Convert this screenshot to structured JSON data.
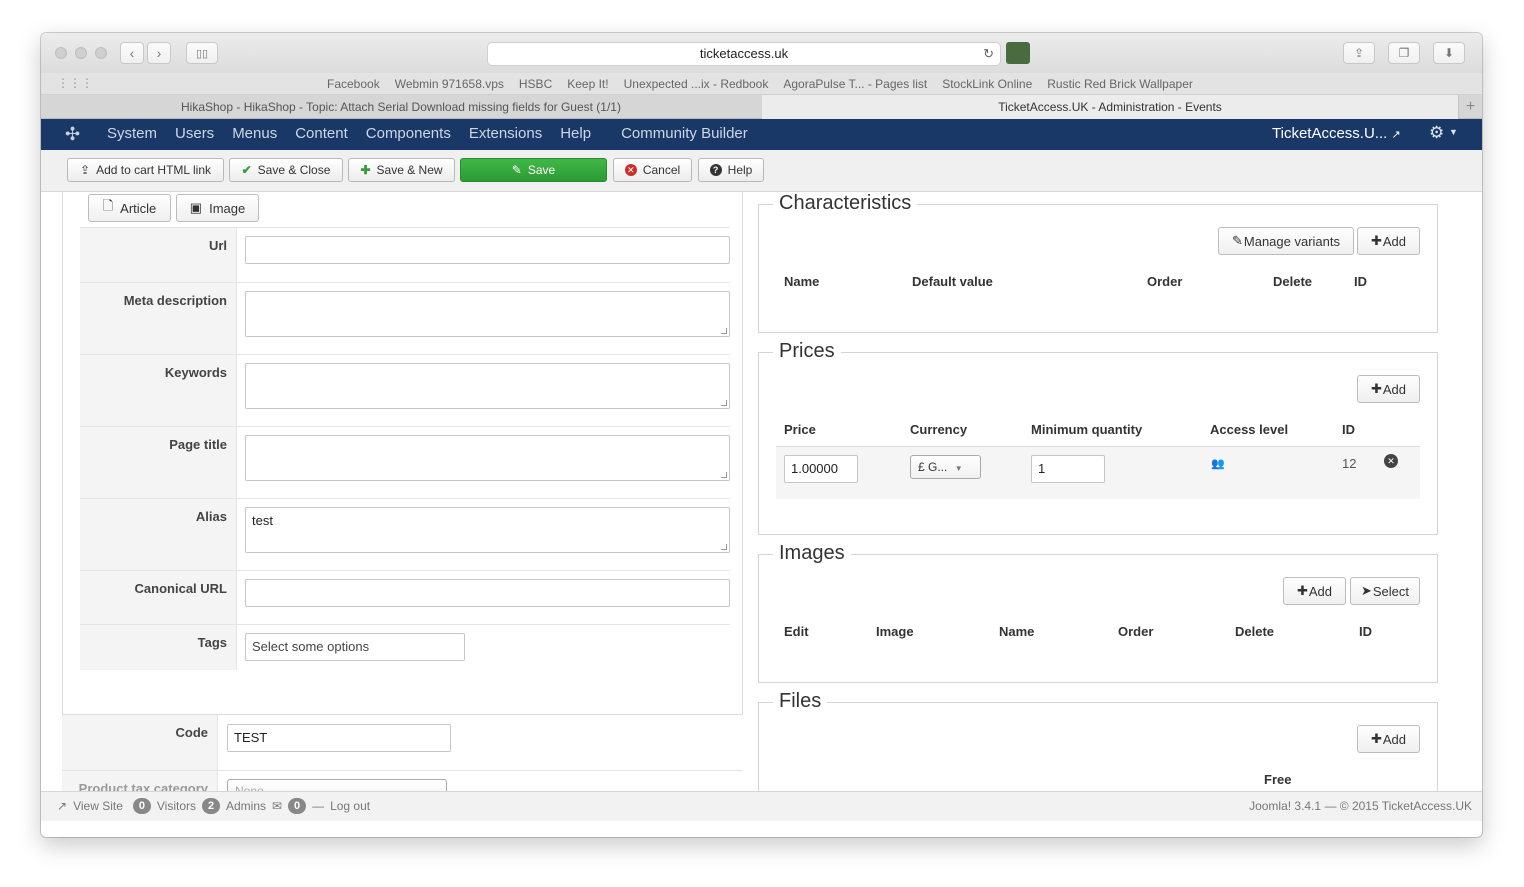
{
  "browser": {
    "url": "ticketaccess.uk",
    "bookmarks": [
      "Facebook",
      "Webmin 971658.vps",
      "HSBC",
      "Keep It!",
      "Unexpected ...ix - Redbook",
      "AgoraPulse T... - Pages list",
      "StockLink Online",
      "Rustic Red Brick Wallpaper"
    ],
    "tabs": [
      {
        "title": "HikaShop - HikaShop - Topic: Attach Serial Download missing fields for Guest (1/1)",
        "active": false
      },
      {
        "title": "TicketAccess.UK - Administration - Events",
        "active": true
      }
    ]
  },
  "navbar": {
    "menu": [
      "System",
      "Users",
      "Menus",
      "Content",
      "Components",
      "Extensions",
      "Help",
      "Community Builder"
    ],
    "site_name": "TicketAccess.U..."
  },
  "toolbar": {
    "add_to_cart": "Add to cart HTML link",
    "save_close": "Save & Close",
    "save_new": "Save & New",
    "save": "Save",
    "cancel": "Cancel",
    "help": "Help"
  },
  "editor_buttons": {
    "article": "Article",
    "image": "Image"
  },
  "meta_form": {
    "url": {
      "label": "Url",
      "value": ""
    },
    "meta_description": {
      "label": "Meta description",
      "value": ""
    },
    "keywords": {
      "label": "Keywords",
      "value": ""
    },
    "page_title": {
      "label": "Page title",
      "value": ""
    },
    "alias": {
      "label": "Alias",
      "value": "test"
    },
    "canonical_url": {
      "label": "Canonical URL",
      "value": ""
    },
    "tags": {
      "label": "Tags",
      "placeholder": "Select some options"
    }
  },
  "product": {
    "code": {
      "label": "Code",
      "value": "TEST"
    },
    "tax_category": {
      "label": "Product tax category",
      "value": "None"
    }
  },
  "characteristics": {
    "legend": "Characteristics",
    "manage_variants": "Manage variants",
    "add": "Add",
    "columns": [
      "Name",
      "Default value",
      "Order",
      "Delete",
      "ID"
    ]
  },
  "prices": {
    "legend": "Prices",
    "add": "Add",
    "columns": [
      "Price",
      "Currency",
      "Minimum quantity",
      "Access level",
      "ID"
    ],
    "rows": [
      {
        "price": "1.00000",
        "currency": "£ G...",
        "min_qty": "1",
        "id": "12"
      }
    ]
  },
  "images": {
    "legend": "Images",
    "add": "Add",
    "select": "Select",
    "columns": [
      "Edit",
      "Image",
      "Name",
      "Order",
      "Delete",
      "ID"
    ]
  },
  "files": {
    "legend": "Files",
    "add": "Add",
    "columns": [
      "Free"
    ]
  },
  "footer": {
    "view_site": "View Site",
    "visitors_count": "0",
    "visitors": "Visitors",
    "admins_count": "2",
    "admins": "Admins",
    "messages_count": "0",
    "logout": "Log out",
    "version": "Joomla! 3.4.1  —  © 2015 TicketAccess.UK"
  },
  "colors": {
    "navbar": "#1a3867",
    "save_green": "#2d9a33",
    "cancel_red": "#c9302c"
  }
}
